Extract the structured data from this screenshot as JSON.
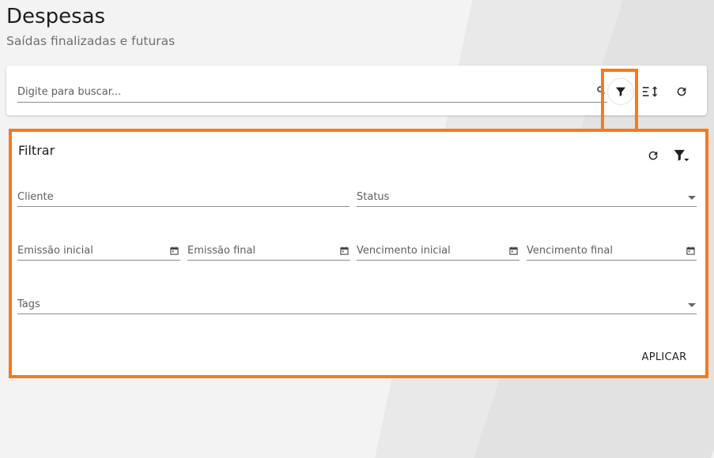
{
  "header": {
    "title": "Despesas",
    "subtitle": "Saídas finalizadas e futuras"
  },
  "search": {
    "placeholder": "Digite para buscar...",
    "value": ""
  },
  "toolbar": {
    "filter_icon": "filter-icon",
    "sort_icon": "sort-icon",
    "refresh_icon": "refresh-icon"
  },
  "filter_panel": {
    "title": "Filtrar",
    "fields": {
      "cliente": "Cliente",
      "status": "Status",
      "emissao_inicial": "Emissão inicial",
      "emissao_final": "Emissão final",
      "vencimento_inicial": "Vencimento inicial",
      "vencimento_final": "Vencimento final",
      "tags": "Tags"
    },
    "apply_label": "APLICAR"
  },
  "colors": {
    "highlight": "#f47a20",
    "background": "#f3f3f3",
    "card": "#ffffff"
  }
}
